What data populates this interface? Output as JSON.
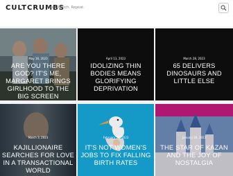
{
  "header": {
    "site_title": "CULTCRUMBS",
    "tagline": "Read. Watch. Repeat.",
    "search_icon": "search-icon"
  },
  "posts": [
    {
      "date": "May 18, 2023",
      "title": "ARE YOU THERE GOD? IT'S ME, MARGARET BRINGS GIRLHOOD TO THE BIG SCREEN"
    },
    {
      "date": "April 13, 2023",
      "title": "IDOLIZING THIN BODIES MEANS GLORIFYING DEPRIVATION"
    },
    {
      "date": "March 28, 2023",
      "title": "65 DELIVERS DINOSAURS AND LITTLE ELSE"
    },
    {
      "date": "March 3, 2023",
      "title": "KAJILLIONAIRE SEARCHES FOR LOVE IN A TRANSACTIONAL WORLD"
    },
    {
      "date": "February 18, 2023",
      "title": "IT'S NOT WOMEN'S JOBS TO FIX FALLING BIRTH RATES"
    },
    {
      "date": "January 28, 2023",
      "title": "THE STAR OF KAZAN AND THE JOY OF NOSTALGIA"
    }
  ],
  "colors": {
    "header_bg": "#ffffff",
    "page_bg": "#f3f3f3",
    "accent_pink": "#d81b8c",
    "accent_cyan": "#1aa6d6"
  }
}
